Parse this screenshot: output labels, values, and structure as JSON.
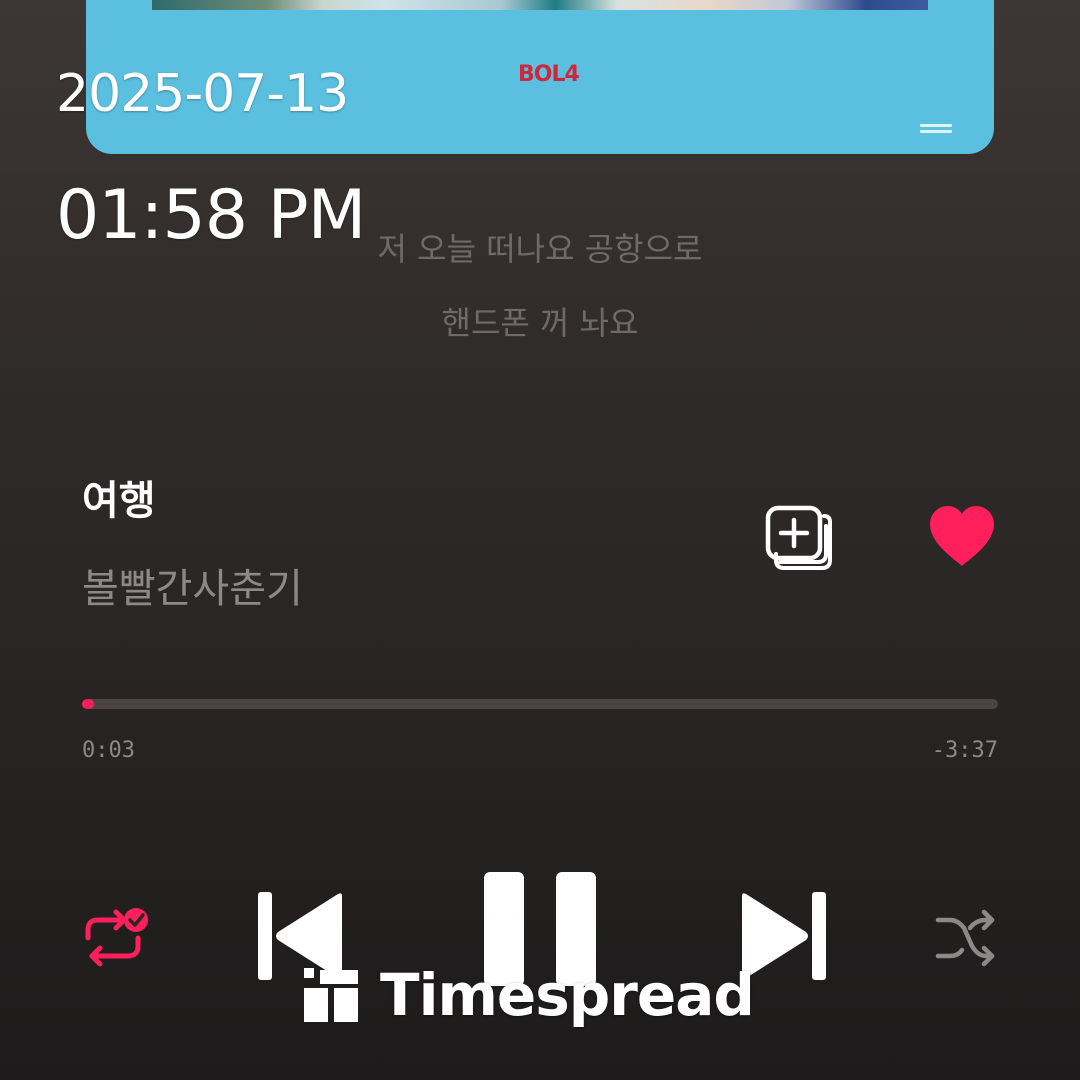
{
  "overlay": {
    "date": "2025-07-13",
    "time": "01:58 PM"
  },
  "album_art": {
    "artist_text": "BOL4"
  },
  "lyrics": {
    "line_1": "저 오늘 떠나요 공항으로",
    "line_2": "핸드폰 꺼 놔요"
  },
  "track": {
    "title": "여행",
    "artist": "볼빨간사춘기",
    "liked": true
  },
  "progress": {
    "elapsed": "0:03",
    "remaining": "-3:37",
    "fraction": 0.0136
  },
  "icons": {
    "add_to_playlist": "add-to-playlist-icon",
    "like": "heart-icon",
    "repeat": "repeat-icon",
    "previous": "previous-track-icon",
    "pause": "pause-icon",
    "next": "next-track-icon",
    "shuffle": "shuffle-icon"
  },
  "colors": {
    "accent": "#ff1f5a",
    "album_bg": "#5bbfe0",
    "text_secondary": "#8e8988"
  },
  "watermark": {
    "text": "Timespread"
  }
}
